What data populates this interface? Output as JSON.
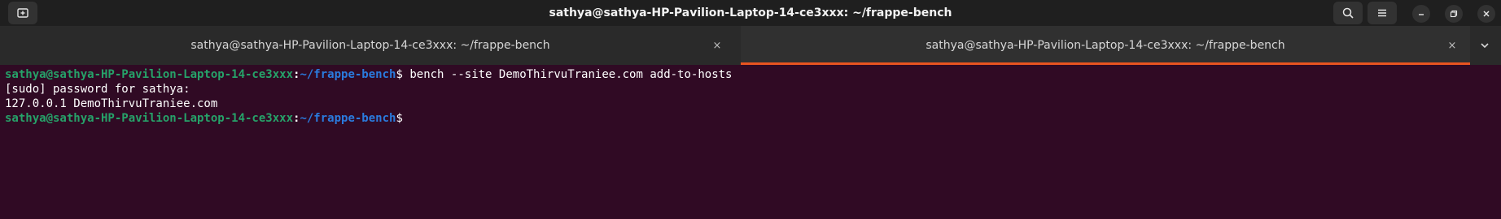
{
  "window": {
    "title": "sathya@sathya-HP-Pavilion-Laptop-14-ce3xxx: ~/frappe-bench"
  },
  "header_icons": {
    "new_tab": "new-tab-icon",
    "search": "search-icon",
    "menu": "hamburger-menu-icon",
    "minimize": "minimize-icon",
    "maximize": "maximize-icon",
    "close": "close-icon"
  },
  "tabs": [
    {
      "label": "sathya@sathya-HP-Pavilion-Laptop-14-ce3xxx: ~/frappe-bench",
      "active": false,
      "close_glyph": "×"
    },
    {
      "label": "sathya@sathya-HP-Pavilion-Laptop-14-ce3xxx: ~/frappe-bench",
      "active": true,
      "close_glyph": "×"
    }
  ],
  "terminal": {
    "prompt_user_host": "sathya@sathya-HP-Pavilion-Laptop-14-ce3xxx",
    "prompt_colon": ":",
    "prompt_path": "~/frappe-bench",
    "prompt_dollar": "$",
    "command": " bench --site DemoThirvuTraniee.com add-to-hosts",
    "output": [
      "[sudo] password for sathya:",
      "127.0.0.1 DemoThirvuTraniee.com"
    ]
  },
  "colors": {
    "terminal_bg": "#300a24",
    "prompt_user": "#26a269",
    "prompt_path": "#2a7bde",
    "tab_accent": "#e95420"
  }
}
